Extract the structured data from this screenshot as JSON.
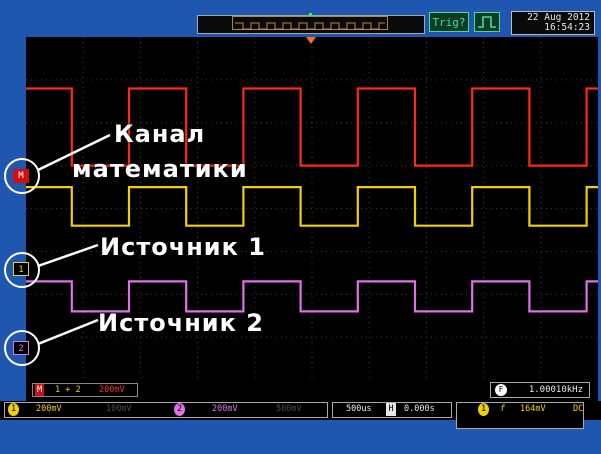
{
  "header": {
    "datetime_line1": "22 Aug 2012",
    "datetime_line2": "16:54:23",
    "trig_status": "Trig?",
    "pulse_icon": "pulse-waveform-icon"
  },
  "channels": {
    "math_marker": "M",
    "ch1_marker": "1",
    "ch2_marker": "2"
  },
  "callouts": {
    "math": [
      "Канал",
      "математики"
    ],
    "source1": "Источник 1",
    "source2": "Источник 2"
  },
  "status_bar_top": {
    "math_label": "M",
    "math_formula": "1 + 2",
    "math_scale": "200mV",
    "freq_label": "F",
    "freq_value": "1.00010kHz"
  },
  "status_bar_bottom": {
    "ch1_id": "1",
    "ch1_scale": "200mV",
    "ch2_id": "2",
    "ch2_scale": "200mV",
    "ch3_scale": "100mV",
    "ch4_scale": "500mV",
    "timebase": "500us",
    "h_icon": "H",
    "h_position": "0.000s",
    "trig_source": "1",
    "trig_slope": "f",
    "trig_level": "164mV",
    "trig_coupling": "DC"
  },
  "colors": {
    "math": "#ff2a10",
    "ch1": "#f0d000",
    "ch2": "#e070e8",
    "frame": "#1f57b0",
    "trigger_ui": "#3de08e"
  },
  "waveforms": {
    "period_us": 1000,
    "duty": 0.5,
    "math_high_level_div": 2.8,
    "math_low_level_div": 1.0,
    "ch1_high_level_div": 0.5,
    "ch1_low_level_div": -0.4,
    "ch2_high_level_div": -1.7,
    "ch2_low_level_div": -2.4
  }
}
